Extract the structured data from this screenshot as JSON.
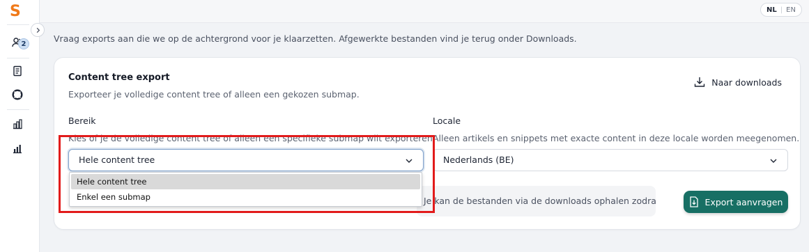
{
  "app": {
    "logo_letter": "S"
  },
  "sidebar": {
    "badge_count": "2",
    "icons": [
      "users-icon",
      "document-list-icon",
      "lifebuoy-icon",
      "building-chart-icon",
      "bar-chart-icon"
    ]
  },
  "topbar": {
    "lang_nl": "NL",
    "lang_en": "EN",
    "active_lang": "NL"
  },
  "intro_text": "Vraag exports aan die we op de achtergrond voor je klaarzetten. Afgewerkte bestanden vind je terug onder Downloads.",
  "card": {
    "title": "Content tree export",
    "subtitle": "Exporteer je volledige content tree of alleen een gekozen submap.",
    "downloads_link": "Naar downloads",
    "scope": {
      "label": "Bereik",
      "help": "Kies of je de volledige content tree of alleen een specifieke submap wilt exporteren.",
      "value": "Hele content tree",
      "options": [
        "Hele content tree",
        "Enkel een submap"
      ]
    },
    "locale": {
      "label": "Locale",
      "help": "Alleen artikels en snippets met exacte content in deze locale worden meegenomen.",
      "value": "Nederlands (BE)"
    },
    "notice": "Je kan de bestanden via de downloads ophalen zodra de export klaar is.",
    "export_button": "Export aanvragen"
  },
  "colors": {
    "brand_orange": "#f07a1a",
    "primary_green": "#176f64",
    "annotation_red": "#e21b1b"
  }
}
